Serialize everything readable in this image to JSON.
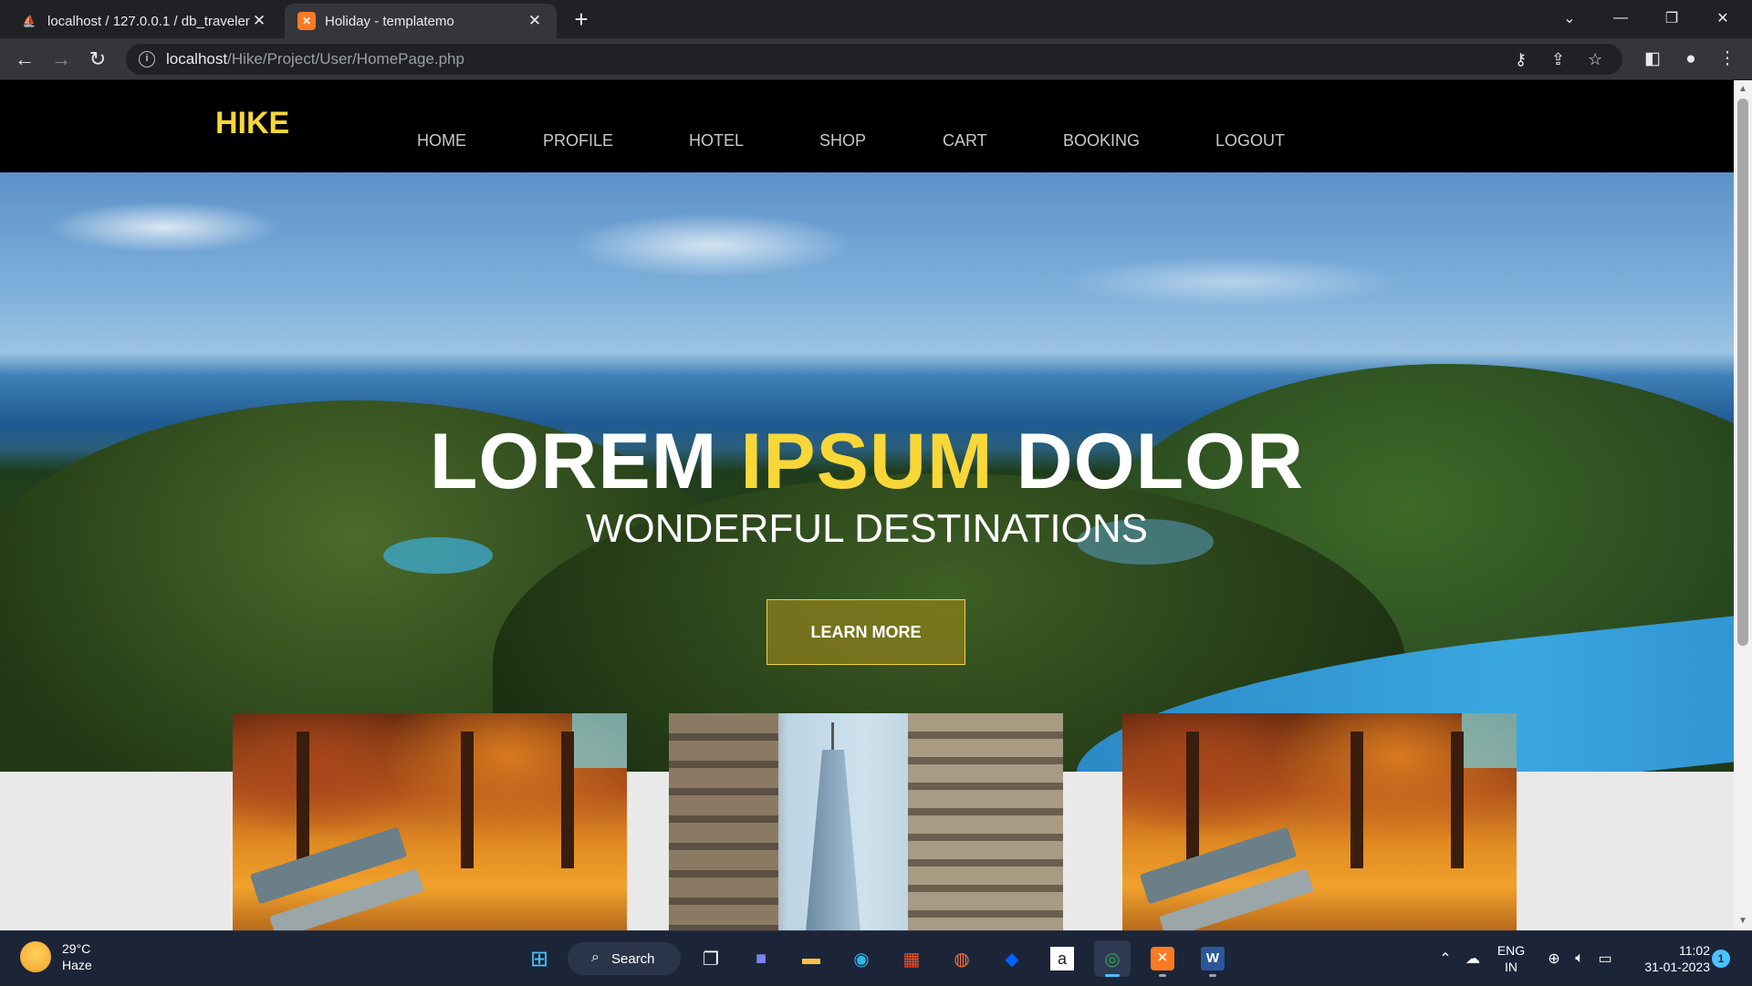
{
  "browser": {
    "tabs": [
      {
        "title": "localhost / 127.0.0.1 / db_traveler",
        "icon": "phpmyadmin-icon",
        "active": false
      },
      {
        "title": "Holiday - templatemo",
        "icon": "xampp-icon",
        "active": true
      }
    ],
    "address": {
      "host": "localhost",
      "path": "/Hike/Project/User/HomePage.php"
    }
  },
  "site": {
    "logo": "HIKE",
    "menu": [
      "HOME",
      "PROFILE",
      "HOTEL",
      "SHOP",
      "CART",
      "BOOKING",
      "LOGOUT"
    ],
    "hero": {
      "title_part1": "LOREM",
      "title_highlight": "IPSUM",
      "title_part3": "DOLOR",
      "subtitle": "WONDERFUL DESTINATIONS",
      "button": "LEARN MORE"
    },
    "colors": {
      "accent": "#f9d738",
      "nav_bg": "#000000",
      "body_bg": "#e9e9e9"
    }
  },
  "taskbar": {
    "weather": {
      "temp": "29°C",
      "condition": "Haze"
    },
    "search_label": "Search",
    "lang_line1": "ENG",
    "lang_line2": "IN",
    "time": "11:02",
    "date": "31-01-2023",
    "notification_count": "1"
  }
}
